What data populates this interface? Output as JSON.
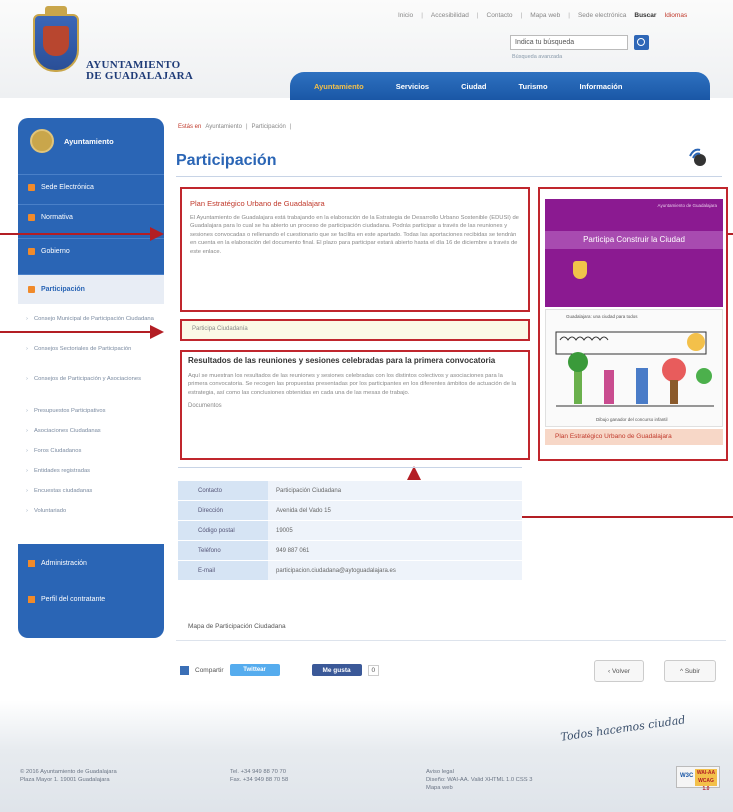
{
  "header": {
    "logo_line1": "AYUNTAMIENTO",
    "logo_line2": "DE GUADALAJARA",
    "top_links": [
      "Inicio",
      "Accesibilidad",
      "Contacto",
      "Mapa web",
      "Sede electrónica"
    ],
    "top_links_extra": [
      "Buscar",
      "Idiomas"
    ],
    "search_value": "Indica tu búsqueda",
    "search_hint": "Búsqueda avanzada",
    "nav": [
      "Ayuntamiento",
      "Servicios",
      "Ciudad",
      "Turismo",
      "Información"
    ]
  },
  "sidebar": {
    "head": "Ayuntamiento",
    "items": [
      "Sede Electrónica",
      "Normativa",
      "Gobierno",
      "Participación"
    ],
    "sub_items": [
      "Consejo Municipal de Participación Ciudadana",
      "Consejos Sectoriales de Participación",
      "Consejos de Participación y Asociaciones",
      "Presupuestos Participativos",
      "Asociaciones Ciudadanas",
      "Foros Ciudadanos",
      "Entidades registradas",
      "Encuestas ciudadanas",
      "Voluntariado"
    ],
    "bottom_items": [
      "Administración",
      "Perfil del contratante"
    ]
  },
  "main": {
    "breadcrumb": [
      "Estás en",
      "Ayuntamiento",
      "Participación"
    ],
    "title": "Participación",
    "box1_title": "Plan Estratégico Urbano de Guadalajara",
    "box1_text": "El Ayuntamiento de Guadalajara está trabajando en la elaboración de la Estrategia de Desarrollo Urbano Sostenible (EDUSI) de Guadalajara para lo cual se ha abierto un proceso de participación ciudadana. Podrás participar a través de las reuniones y sesiones convocadas o rellenando el cuestionario que se facilita en este apartado. Todas las aportaciones recibidas se tendrán en cuenta en la elaboración del documento final. El plazo para participar estará abierto hasta el día 16 de diciembre a través de este enlace.",
    "box2_text": "Participa Ciudadanía",
    "box3_title": "Resultados de las reuniones y sesiones celebradas para la primera convocatoria",
    "box3_text": "Aquí se muestran los resultados de las reuniones y sesiones celebradas con los distintos colectivos y asociaciones para la primera convocatoria. Se recogen las propuestas presentadas por los participantes en los diferentes ámbitos de actuación de la estrategia, así como las conclusiones obtenidas en cada una de las mesas de trabajo.",
    "box3_link": "Documentos",
    "promo_small": "Ayuntamiento de Guadalajara",
    "promo_band": "Participa Construir la Ciudad",
    "drawing_top": "Guadalajara: una ciudad para todos",
    "drawing_bottom": "Dibujo ganador del concurso infantil",
    "promo_bar": "Plan Estratégico Urbano de Guadalajara",
    "contact_rows": [
      {
        "label": "Contacto",
        "value": "Participación Ciudadana"
      },
      {
        "label": "Dirección",
        "value": "Avenida del Vado 15"
      },
      {
        "label": "Código postal",
        "value": "19005"
      },
      {
        "label": "Teléfono",
        "value": "949 887 061"
      },
      {
        "label": "E-mail",
        "value": "participacion.ciudadana@aytoguadalajara.es"
      }
    ],
    "map_link": "Mapa de Participación Ciudadana",
    "share_label": "Compartir",
    "tweet_label": "Twittear",
    "like_label": "Me gusta",
    "like_count": "0",
    "back_label": "Volver",
    "up_label": "Subir"
  },
  "footer": {
    "script": "Todos hacemos ciudad",
    "col1": [
      "© 2016 Ayuntamiento de Guadalajara",
      "Plaza Mayor 1. 19001 Guadalajara"
    ],
    "col2": [
      "Tel. +34 949 88 70 70",
      "Fax. +34 949 88 70 58"
    ],
    "col3": [
      "Aviso legal",
      "Diseño: WAI-AA. Valid XHTML 1.0 CSS 3",
      "Mapa web"
    ],
    "badge_w3": "W3C",
    "badge_wai": "WAI-AA WCAG 1.0"
  },
  "colors": {
    "brand_blue": "#2a65b5",
    "annotation_red": "#c0262d",
    "accent_orange": "#f08a2a",
    "promo_purple": "#8b1a91"
  }
}
